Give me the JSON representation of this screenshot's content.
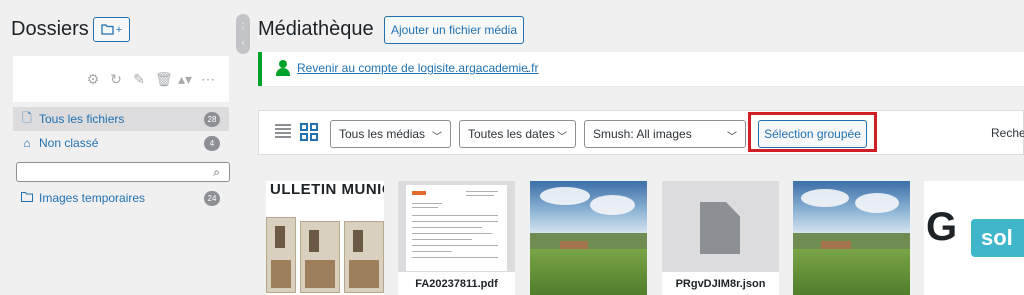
{
  "folders": {
    "title": "Dossiers",
    "add_folder_icon": "folder-plus-icon",
    "add_folder_plus": "+",
    "toolbar_icons": [
      "gear-icon",
      "refresh-icon",
      "pencil-icon",
      "trash-icon",
      "sort-icon",
      "more-icon"
    ],
    "items": [
      {
        "label": "Tous les fichiers",
        "count": "28",
        "icon": "file-icon",
        "active": true
      },
      {
        "label": "Non classé",
        "count": "4",
        "icon": "home-icon",
        "active": false
      }
    ],
    "search_placeholder": "",
    "subfolders": [
      {
        "label": "Images temporaires",
        "count": "24",
        "icon": "folder-icon"
      }
    ]
  },
  "header": {
    "title": "Médiathèque",
    "add_media_label": "Ajouter un fichier média"
  },
  "notice": {
    "link_text": "Revenir au compte de logisite.argacademie.fr",
    "suffix": ".",
    "accent": "#00a32a"
  },
  "toolbar": {
    "filter_type": "Tous les médias",
    "filter_dates": "Toutes les dates",
    "filter_smush": "Smush: All images",
    "bulk_select_label": "Sélection groupée",
    "search_label": "Recher",
    "highlight_color": "#d01f26"
  },
  "thumbnails": [
    {
      "kind": "bulletin",
      "header_text": "ULLETIN MUNICIPA"
    },
    {
      "kind": "document",
      "caption": "FA20237811.pdf"
    },
    {
      "kind": "landscape"
    },
    {
      "kind": "file",
      "caption": "PRgvDJIM8r.json"
    },
    {
      "kind": "landscape"
    },
    {
      "kind": "logo",
      "logo_letter": "G",
      "logo_text": "sol"
    }
  ],
  "colors": {
    "accent": "#2271b1",
    "background": "#f0f0f1"
  }
}
